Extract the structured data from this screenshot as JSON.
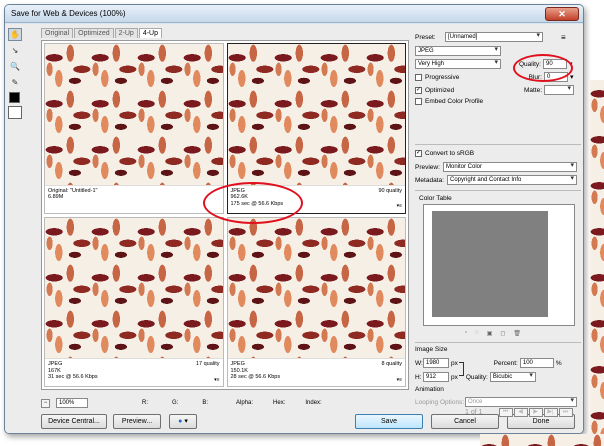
{
  "window": {
    "title": "Save for Web & Devices (100%)",
    "close_label": "✕"
  },
  "tabs": [
    "Original",
    "Optimized",
    "2-Up",
    "4-Up"
  ],
  "panes": [
    {
      "line1": "Original: \"Untitled-1\"",
      "line2": "6.89M",
      "line3": "",
      "right": ""
    },
    {
      "line1": "JPEG",
      "line2": "962.6K",
      "line3": "175 sec @ 56.6 Kbps",
      "right": "90 quality"
    },
    {
      "line1": "JPEG",
      "line2": "167K",
      "line3": "31 sec @ 56.6 Kbps",
      "right": "17 quality"
    },
    {
      "line1": "JPEG",
      "line2": "150.1K",
      "line3": "28 sec @ 56.6 Kbps",
      "right": "8 quality"
    }
  ],
  "bottom_bar": {
    "zoom": "100%",
    "r": "R:",
    "g": "G:",
    "b": "B:",
    "alpha": "Alpha:",
    "hex": "Hex:",
    "index": "Index:"
  },
  "buttons": {
    "device_central": "Device Central...",
    "preview": "Preview...",
    "save": "Save",
    "cancel": "Cancel",
    "done": "Done"
  },
  "settings": {
    "preset_label": "Preset:",
    "preset_value": "[Unnamed]",
    "format": "JPEG",
    "compression": "Very High",
    "quality_label": "Quality:",
    "quality_value": "90",
    "blur_label": "Blur:",
    "blur_value": "0",
    "progressive": "Progressive",
    "optimized": "Optimized",
    "matte_label": "Matte:",
    "embed_profile": "Embed Color Profile",
    "convert_srgb": "Convert to sRGB",
    "preview_label": "Preview:",
    "preview_value": "Monitor Color",
    "metadata_label": "Metadata:",
    "metadata_value": "Copyright and Contact Info",
    "color_table_label": "Color Table"
  },
  "image_size": {
    "heading": "Image Size",
    "w_label": "W:",
    "w_value": "1980",
    "h_label": "H:",
    "h_value": "912",
    "unit": "px",
    "percent_label": "Percent:",
    "percent_value": "100",
    "percent_unit": "%",
    "quality_label": "Quality:",
    "quality_value": "Bicubic"
  },
  "animation": {
    "heading": "Animation",
    "looping_label": "Looping Options:",
    "looping_value": "Once",
    "frame_counter": "1 of 1"
  },
  "colors": {
    "annotation": "#e0101e",
    "swatch": "#808080"
  }
}
